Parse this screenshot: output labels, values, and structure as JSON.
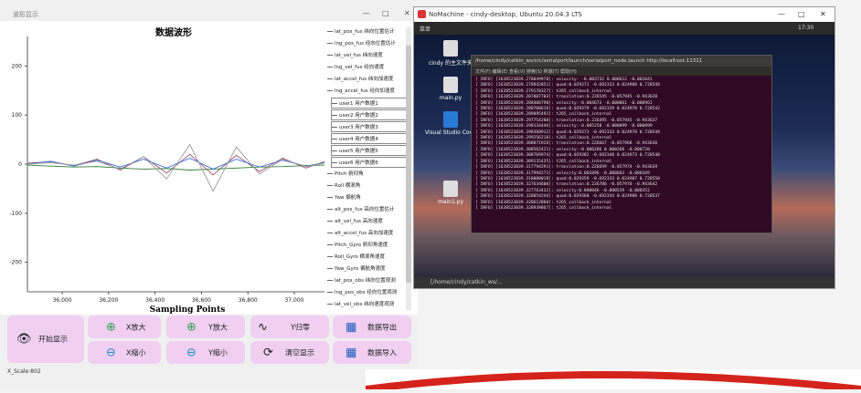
{
  "wave_window": {
    "title": "波形显示",
    "chart_title": "数据波形",
    "xlabel": "Sampling Points",
    "y_ticks": [
      "200",
      "100",
      "0",
      "-100",
      "-200"
    ],
    "x_ticks": [
      "36,000",
      "36,200",
      "36,400",
      "36,600",
      "36,800",
      "37,000"
    ],
    "legend": [
      "lat_pos_fus 纬向位置估计",
      "lng_pos_fus 经向位置估计",
      "lat_vel_fus 纬向速度",
      "lng_vel_fus 经向速度",
      "lat_accel_fus 纬向加速度",
      "lng_accel_fus 经向加速度",
      "user1 用户数据1",
      "user2 用户数据2",
      "user3 用户数据3",
      "user4 用户数据4",
      "user5 用户数据5",
      "user6 用户数据6",
      "Pitch 俯仰角",
      "Roll 横滚角",
      "Yaw 偏航角",
      "alt_pos_fus 高向位置估计",
      "alt_vel_fus 高向速度",
      "alt_accel_fus 高向加速度",
      "Pitch_Gyro 俯仰角速度",
      "Roll_Gyro 横滚角速度",
      "Yaw_Gyro 偏航角速度",
      "lat_pos_obs 纬向位置观测",
      "lng_pos_obs 经向位置观测",
      "lat_vel_obs 纬向速度观测"
    ],
    "buttons": {
      "start": "开始显示",
      "x_zoom_in": "X放大",
      "y_zoom_in": "Y放大",
      "y_reset": "Y归零",
      "export": "数据导出",
      "x_zoom_out": "X缩小",
      "y_zoom_out": "Y缩小",
      "clear": "清空显示",
      "import": "数据导入"
    },
    "status": "X_Scale:802"
  },
  "nomachine": {
    "title": "NoMachine - cindy-desktop, Ubuntu 20.04.3 LTS",
    "topbar_left": "菜单",
    "clock": "17:30",
    "icons": [
      "cindy 的主文件夹",
      "main.py",
      "Visual Studio Code",
      "main1.py"
    ],
    "terminal_title": "/home/cindy/catkin_ws/src/serialport/launch/serialport_node.launch http://localhost:11311",
    "terminal_menu": "文件(F)  编辑(E)  查看(V)  搜索(S)  终端(T)  帮助(H)",
    "terminal_lines": [
      "[ INFO] [1638523839.278049978]: velocity: -0.003732 0.000612 -0.001041",
      "[ INFO] [1638523839.278942851]: quad:0.029371 -0.692333 0.024988 0.728548",
      "[ INFO] [1638523839.279170327]: t265_callback_internal",
      "[ INFO] [1638523839.287807703]: translation:0.226545 -0.057945 -0.943628",
      "[ INFO] [1638523839.288406790]: velocity:-0.004673 -0.000061 -0.000961",
      "[ INFO] [1638523839.288700616]: quad:0.029379 -0.692339 0.024978 0.728542",
      "[ INFO] [1638523839.289095492]: t265_callback_internal",
      "[ INFO] [1638523839.297754208]: translation:0.226495 -0.057945 -0.943637",
      "[ INFO] [1638523839.298134446]: velocity:-0.005258 -0.000099 -0.000899",
      "[ INFO] [1638523839.298360912]: quad:0.029373 -0.692333 0.024978 0.728548",
      "[ INFO] [1638523839.299256218]: t265_callback_internal",
      "[ INFO] [1638523839.308071926]: translation:0.226667 -0.057968 -0.943636",
      "[ INFO] [1638523839.308562421]: velocity:-0.006286 0.000268 -0.000720",
      "[ INFO] [1638523839.308769974]: quad:0.029382 -0.692340 0.024973 0.728540",
      "[ INFO] [1638523839.309135435]: t265_callback_internal",
      "[ INFO] [1638523839.317794291]: translation:0.226699 -0.057974 -0.943639",
      "[ INFO] [1638523839.317994271]: velocity:0.001096 -0.000603 -0.000349",
      "[ INFO] [1638523839.318000018]: quad:0.029359 -0.692333 0.024987 0.728550",
      "[ INFO] [1638523839.327634600]: translation:0.226706 -0.057970 -0.943642",
      "[ INFO] [1638523839.327763432]: velocity:0.000046 -0.000539 -0.000352",
      "[ INFO] [1638523839.328054244]: quad:0.029360 -0.692344 0.024988 0.728537",
      "[ INFO] [1638523839.328612860]: t265_callback_internal",
      "[ INFO] [1638523839.328939067]: t265_callback_internal"
    ],
    "taskbar_path": "[/home/cindy/catkin_ws/..."
  },
  "chart_data": {
    "type": "line",
    "title": "数据波形",
    "xlabel": "Sampling Points",
    "xlim": [
      35850,
      37130
    ],
    "ylim": [
      -260,
      260
    ],
    "series": [
      {
        "color": "#9b4a6e",
        "x": [
          35850,
          35950,
          36050,
          36150,
          36250,
          36350,
          36450,
          36550,
          36650,
          36750,
          36850,
          36950,
          37050,
          37130
        ],
        "values": [
          2,
          5,
          -3,
          10,
          -12,
          15,
          -18,
          20,
          -22,
          18,
          -15,
          12,
          -8,
          5
        ]
      },
      {
        "color": "#2e7d32",
        "x": [
          35850,
          35950,
          36050,
          36150,
          36250,
          36350,
          36450,
          36550,
          36650,
          36750,
          36850,
          36950,
          37050,
          37130
        ],
        "values": [
          -2,
          -4,
          -6,
          -5,
          -8,
          -10,
          -9,
          -12,
          -10,
          -8,
          -6,
          -5,
          -3,
          -2
        ]
      },
      {
        "color": "#3a6fd8",
        "x": [
          35850,
          35950,
          36050,
          36150,
          36250,
          36350,
          36450,
          36550,
          36650,
          36750,
          36850,
          36950,
          37050,
          37130
        ],
        "values": [
          0,
          6,
          -4,
          8,
          -6,
          10,
          -8,
          12,
          -10,
          10,
          -6,
          8,
          -4,
          3
        ]
      },
      {
        "color": "#999999",
        "x": [
          35850,
          35950,
          36050,
          36150,
          36250,
          36350,
          36450,
          36550,
          36650,
          36750,
          36850,
          36950,
          37050,
          37130
        ],
        "values": [
          0,
          3,
          -2,
          6,
          -10,
          15,
          -30,
          40,
          -55,
          35,
          -20,
          10,
          -5,
          2
        ]
      }
    ]
  }
}
